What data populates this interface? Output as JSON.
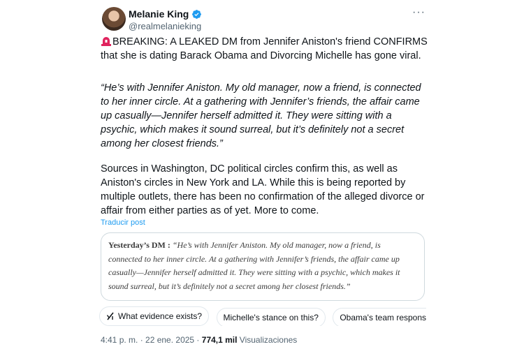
{
  "author": {
    "name": "Melanie King",
    "handle": "@realmelanieking"
  },
  "post": {
    "paragraph1": "BREAKING: A LEAKED DM from Jennifer Aniston's friend CONFIRMS that she is dating Barack Obama and Divorcing Michelle has gone viral.",
    "paragraph2": "“He’s with Jennifer Aniston. My old manager, now a friend, is connected to her inner circle. At a gathering with Jennifer’s friends, the affair came up casually—Jennifer herself admitted it. They were sitting with a psychic, which makes it sound surreal, but it’s definitely not a secret among her closest friends.”",
    "paragraph3": "Sources in Washington, DC political circles confirm this, as well as Aniston's circles in New York and LA. While this is being reported by multiple outlets, there has been no confirmation of the alleged divorce or affair from either parties as of yet. More to come.",
    "translate_label": "Traducir post"
  },
  "card": {
    "lead": "Yesterday’s DM :",
    "body": " “He’s with Jennifer Aniston. My old manager, now a friend, is connected to her inner circle. At a gathering with Jennifer’s friends, the affair came up casually—Jennifer herself admitted it. They were sitting with a psychic, which makes it sound surreal, but it’s definitely not a secret among her closest friends.”"
  },
  "grok_chips": [
    {
      "label": "What evidence exists?"
    },
    {
      "label": "Michelle's stance on this?"
    },
    {
      "label": "Obama's team response?"
    }
  ],
  "meta": {
    "timestamp": "4:41 p. m. · 22 ene. 2025 · ",
    "views_count": "774,1 mil",
    "views_label": " Visualizaciones"
  },
  "colors": {
    "verified": "#1d9bf0",
    "link": "#1d9bf0",
    "siren": "#e0245e"
  },
  "icons": [
    "verified-badge-icon",
    "more-options-icon",
    "siren-emoji-icon",
    "grok-icon"
  ]
}
